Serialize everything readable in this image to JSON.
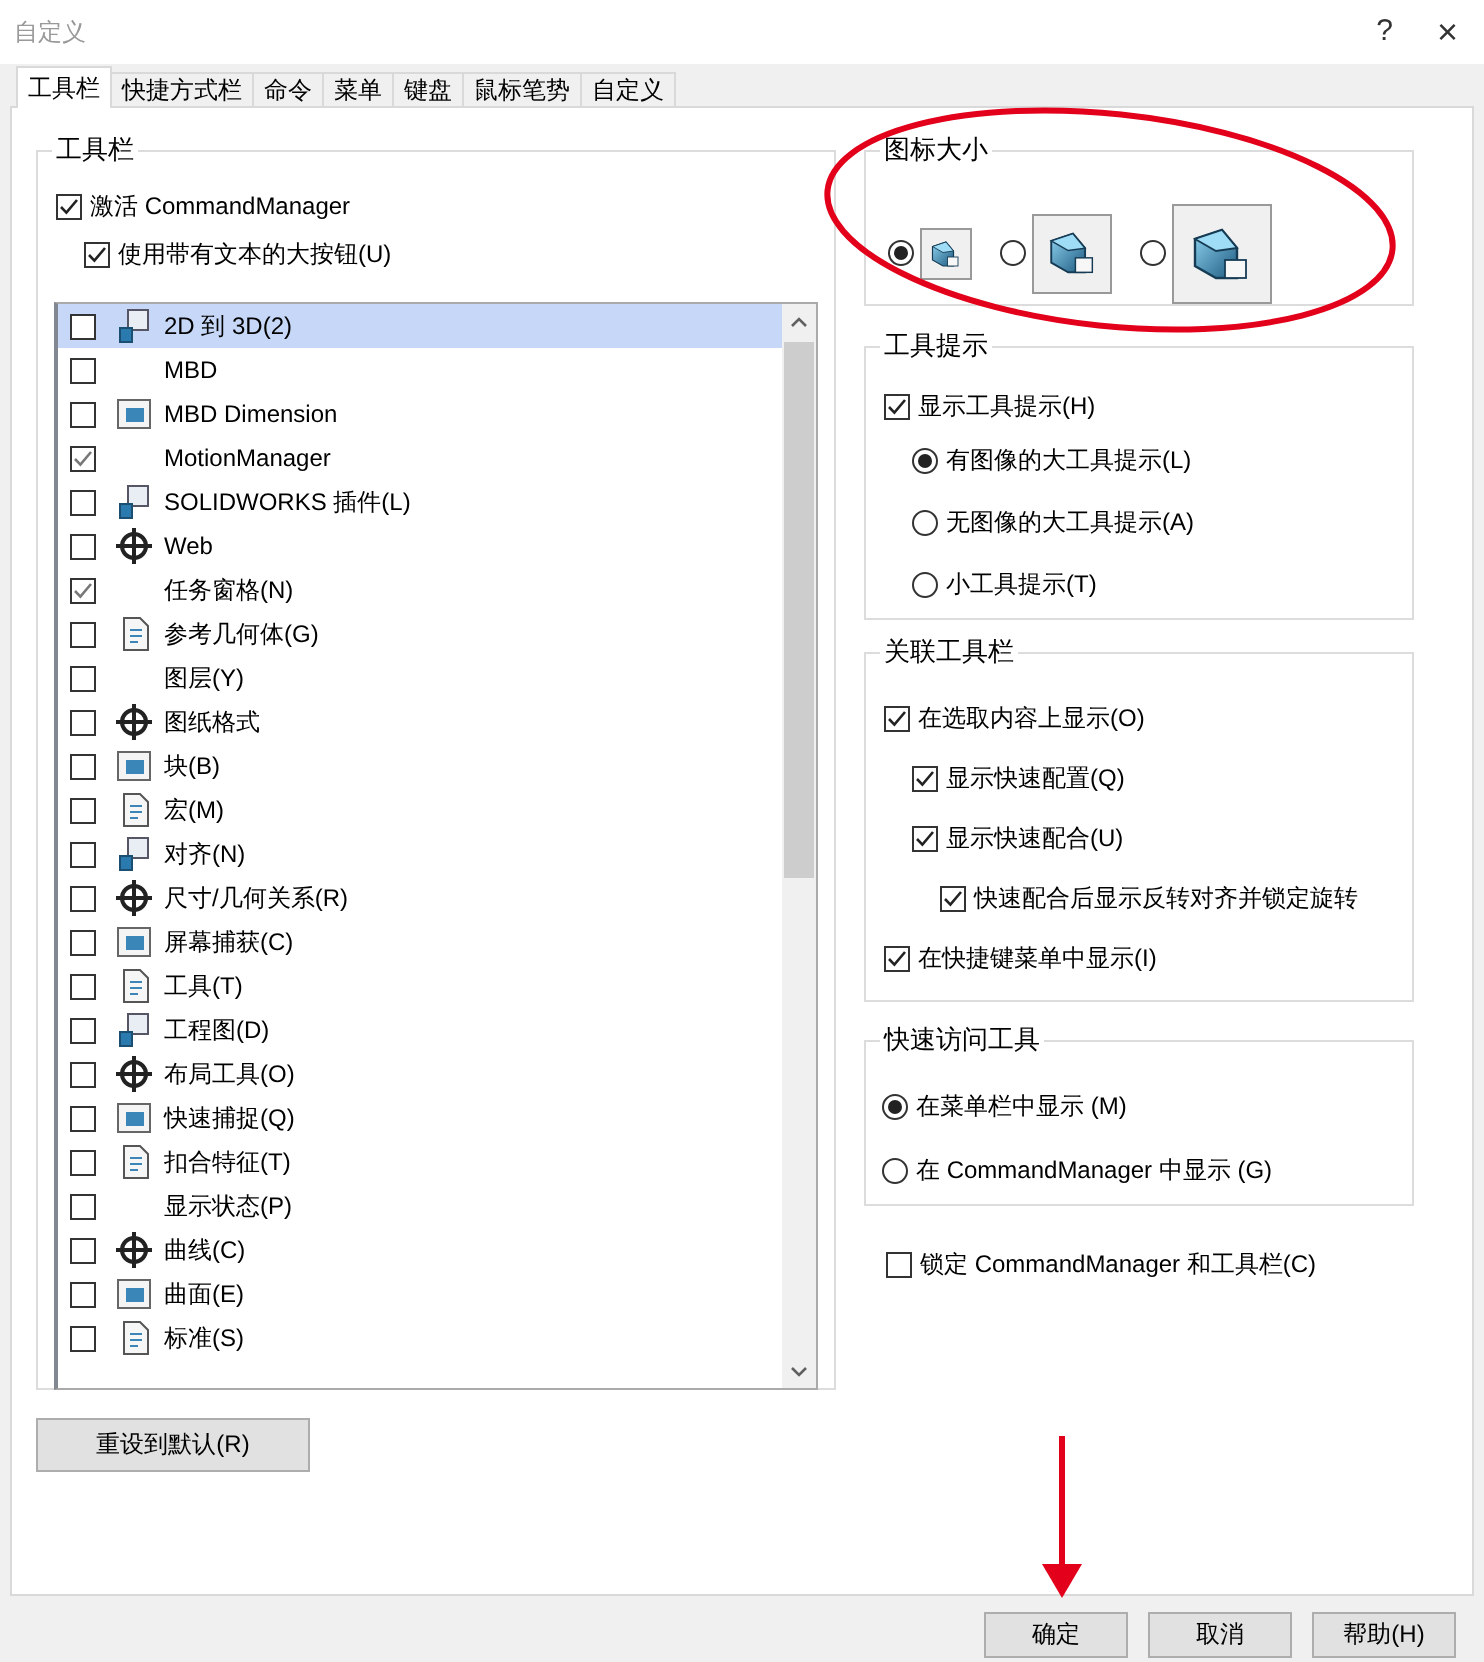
{
  "window": {
    "title": "自定义",
    "help": "?",
    "close": "×"
  },
  "tabs": [
    {
      "label": "工具栏",
      "selected": true
    },
    {
      "label": "快捷方式栏",
      "selected": false
    },
    {
      "label": "命令",
      "selected": false
    },
    {
      "label": "菜单",
      "selected": false
    },
    {
      "label": "键盘",
      "selected": false
    },
    {
      "label": "鼠标笔势",
      "selected": false
    },
    {
      "label": "自定义",
      "selected": false
    }
  ],
  "toolbars": {
    "title": "工具栏",
    "options": [
      {
        "label": "激活 CommandManager",
        "checked": true,
        "children": [
          {
            "label": "使用带有文本的大按钮(U)",
            "checked": true
          }
        ]
      }
    ],
    "list": [
      {
        "label": "2D 到 3D(2)",
        "checked": false,
        "selected": true,
        "icon": true
      },
      {
        "label": "MBD",
        "checked": false,
        "selected": false,
        "icon": false
      },
      {
        "label": "MBD Dimension",
        "checked": false,
        "selected": false,
        "icon": true
      },
      {
        "label": "MotionManager",
        "checked": true,
        "selected": false,
        "icon": false
      },
      {
        "label": "SOLIDWORKS 插件(L)",
        "checked": false,
        "selected": false,
        "icon": true
      },
      {
        "label": "Web",
        "checked": false,
        "selected": false,
        "icon": true
      },
      {
        "label": "任务窗格(N)",
        "checked": true,
        "selected": false,
        "icon": false
      },
      {
        "label": "参考几何体(G)",
        "checked": false,
        "selected": false,
        "icon": true
      },
      {
        "label": "图层(Y)",
        "checked": false,
        "selected": false,
        "icon": false
      },
      {
        "label": "图纸格式",
        "checked": false,
        "selected": false,
        "icon": true
      },
      {
        "label": "块(B)",
        "checked": false,
        "selected": false,
        "icon": true
      },
      {
        "label": "宏(M)",
        "checked": false,
        "selected": false,
        "icon": true
      },
      {
        "label": "对齐(N)",
        "checked": false,
        "selected": false,
        "icon": true
      },
      {
        "label": "尺寸/几何关系(R)",
        "checked": false,
        "selected": false,
        "icon": true
      },
      {
        "label": "屏幕捕获(C)",
        "checked": false,
        "selected": false,
        "icon": true
      },
      {
        "label": "工具(T)",
        "checked": false,
        "selected": false,
        "icon": true
      },
      {
        "label": "工程图(D)",
        "checked": false,
        "selected": false,
        "icon": true
      },
      {
        "label": "布局工具(O)",
        "checked": false,
        "selected": false,
        "icon": true
      },
      {
        "label": "快速捕捉(Q)",
        "checked": false,
        "selected": false,
        "icon": true
      },
      {
        "label": "扣合特征(T)",
        "checked": false,
        "selected": false,
        "icon": true
      },
      {
        "label": "显示状态(P)",
        "checked": false,
        "selected": false,
        "icon": false
      },
      {
        "label": "曲线(C)",
        "checked": false,
        "selected": false,
        "icon": true
      },
      {
        "label": "曲面(E)",
        "checked": false,
        "selected": false,
        "icon": true
      },
      {
        "label": "标准(S)",
        "checked": false,
        "selected": false,
        "icon": true
      }
    ],
    "reset_button": "重设到默认(R)"
  },
  "icon_size": {
    "title": "图标大小",
    "options": [
      {
        "selected": true
      },
      {
        "selected": false
      },
      {
        "selected": false
      }
    ]
  },
  "tooltips": {
    "title": "工具提示",
    "show": {
      "label": "显示工具提示(H)",
      "checked": true
    },
    "options": [
      {
        "label": "有图像的大工具提示(L)",
        "selected": true
      },
      {
        "label": "无图像的大工具提示(A)",
        "selected": false
      },
      {
        "label": "小工具提示(T)",
        "selected": false
      }
    ]
  },
  "context_toolbar": {
    "title": "关联工具栏",
    "options": [
      {
        "label": "在选取内容上显示(O)",
        "checked": true,
        "children": [
          {
            "label": "显示快速配置(Q)",
            "checked": true
          },
          {
            "label": "显示快速配合(U)",
            "checked": true,
            "children": [
              {
                "label": "快速配合后显示反转对齐并锁定旋转",
                "checked": true
              }
            ]
          }
        ]
      },
      {
        "label": "在快捷键菜单中显示(I)",
        "checked": true
      }
    ]
  },
  "quick_access": {
    "title": "快速访问工具",
    "options": [
      {
        "label": "在菜单栏中显示 (M)",
        "selected": true
      },
      {
        "label": "在 CommandManager 中显示 (G)",
        "selected": false
      }
    ]
  },
  "lock": {
    "label": "锁定 CommandManager 和工具栏(C)",
    "checked": false
  },
  "buttons": [
    {
      "label": "确定"
    },
    {
      "label": "取消"
    },
    {
      "label": "帮助(H)"
    }
  ]
}
